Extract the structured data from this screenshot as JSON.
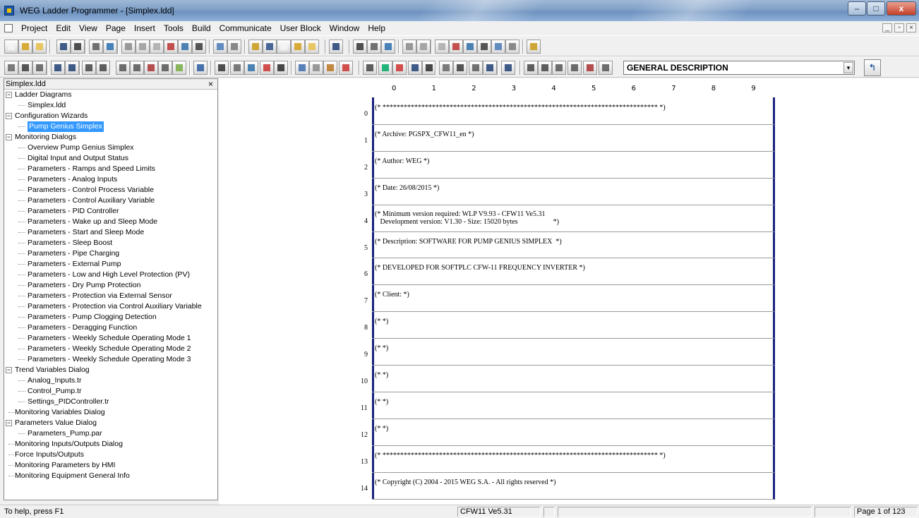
{
  "window": {
    "title": "WEG Ladder Programmer - [Simplex.ldd]",
    "controls": {
      "minimize": "–",
      "maximize": "□",
      "close": "x"
    }
  },
  "menu": {
    "items": [
      "Project",
      "Edit",
      "View",
      "Page",
      "Insert",
      "Tools",
      "Build",
      "Communicate",
      "User Block",
      "Window",
      "Help"
    ],
    "mdi_controls": [
      "_",
      "▫",
      "×"
    ]
  },
  "toolbar": {
    "description_value": "GENERAL DESCRIPTION",
    "dropdown_glyph": "▾",
    "toggle_glyph": "↰"
  },
  "tree": {
    "header": "Simplex.ldd",
    "close_glyph": "×",
    "nodes": [
      {
        "label": "Ladder Diagrams",
        "level": 0,
        "expander": "−"
      },
      {
        "label": "Simplex.ldd",
        "level": 1
      },
      {
        "label": "Configuration Wizards",
        "level": 0,
        "expander": "−"
      },
      {
        "label": "Pump Genius Simplex",
        "level": 1,
        "selected": true
      },
      {
        "label": "Monitoring Dialogs",
        "level": 0,
        "expander": "−"
      },
      {
        "label": "Overview Pump Genius Simplex",
        "level": 1
      },
      {
        "label": "Digital Input and Output Status",
        "level": 1
      },
      {
        "label": "Parameters - Ramps and Speed Limits",
        "level": 1
      },
      {
        "label": "Parameters - Analog Inputs",
        "level": 1
      },
      {
        "label": "Parameters - Control Process Variable",
        "level": 1
      },
      {
        "label": "Parameters - Control Auxiliary Variable",
        "level": 1
      },
      {
        "label": "Parameters - PID Controller",
        "level": 1
      },
      {
        "label": "Parameters - Wake up and Sleep Mode",
        "level": 1
      },
      {
        "label": "Parameters - Start and Sleep Mode",
        "level": 1
      },
      {
        "label": "Parameters - Sleep Boost",
        "level": 1
      },
      {
        "label": "Parameters - Pipe Charging",
        "level": 1
      },
      {
        "label": "Parameters - External Pump",
        "level": 1
      },
      {
        "label": "Parameters - Low and High Level Protection (PV)",
        "level": 1
      },
      {
        "label": "Parameters - Dry Pump Protection",
        "level": 1
      },
      {
        "label": "Parameters - Protection via External Sensor",
        "level": 1
      },
      {
        "label": "Parameters - Protection via Control Auxiliary Variable",
        "level": 1
      },
      {
        "label": "Parameters - Pump Clogging Detection",
        "level": 1
      },
      {
        "label": "Parameters - Deragging Function",
        "level": 1
      },
      {
        "label": "Parameters - Weekly Schedule Operating Mode 1",
        "level": 1
      },
      {
        "label": "Parameters - Weekly Schedule Operating Mode 2",
        "level": 1
      },
      {
        "label": "Parameters - Weekly Schedule Operating Mode 3",
        "level": 1
      },
      {
        "label": "Trend Variables Dialog",
        "level": 0,
        "expander": "−"
      },
      {
        "label": "Analog_Inputs.tr",
        "level": 1
      },
      {
        "label": "Control_Pump.tr",
        "level": 1
      },
      {
        "label": "Settings_PIDController.tr",
        "level": 1
      },
      {
        "label": "Monitoring Variables Dialog",
        "level": 0
      },
      {
        "label": "Parameters Value Dialog",
        "level": 0,
        "expander": "−"
      },
      {
        "label": "Parameters_Pump.par",
        "level": 1
      },
      {
        "label": "Monitoring Inputs/Outputs Dialog",
        "level": 0
      },
      {
        "label": "Force Inputs/Outputs",
        "level": 0
      },
      {
        "label": "Monitoring Parameters by HMI",
        "level": 0
      },
      {
        "label": "Monitoring Equipment General Info",
        "level": 0
      }
    ]
  },
  "ladder": {
    "columns": [
      "0",
      "1",
      "2",
      "3",
      "4",
      "5",
      "6",
      "7",
      "8",
      "9"
    ],
    "rows": [
      {
        "num": "0",
        "text": "(* ****************************************************************************** *)"
      },
      {
        "num": "1",
        "text": "(* Archive: PGSPX_CFW11_en *)"
      },
      {
        "num": "2",
        "text": "(* Author: WEG *)"
      },
      {
        "num": "3",
        "text": "(* Date: 26/08/2015 *)"
      },
      {
        "num": "4",
        "text": "(* Minimum version required: WLP V9.93 - CFW11 Ve5.31\n   Development version: V1.30 - Size: 15020 bytes                    *)"
      },
      {
        "num": "5",
        "text": "(* Description: SOFTWARE FOR PUMP GENIUS SIMPLEX  *)"
      },
      {
        "num": "6",
        "text": "(* DEVELOPED FOR SOFTPLC CFW-11 FREQUENCY INVERTER *)"
      },
      {
        "num": "7",
        "text": "(* Client: *)"
      },
      {
        "num": "8",
        "text": "(* *)"
      },
      {
        "num": "9",
        "text": "(* *)"
      },
      {
        "num": "10",
        "text": "(* *)"
      },
      {
        "num": "11",
        "text": "(* *)"
      },
      {
        "num": "12",
        "text": "(* *)"
      },
      {
        "num": "13",
        "text": "(* ****************************************************************************** *)"
      },
      {
        "num": "14",
        "text": "(* Copyright (C) 2004 - 2015 WEG S.A. - All rights reserved *)"
      }
    ]
  },
  "status": {
    "help": "To help, press F1",
    "device": "CFW11 Ve5.31",
    "page": "Page 1 of 123"
  }
}
